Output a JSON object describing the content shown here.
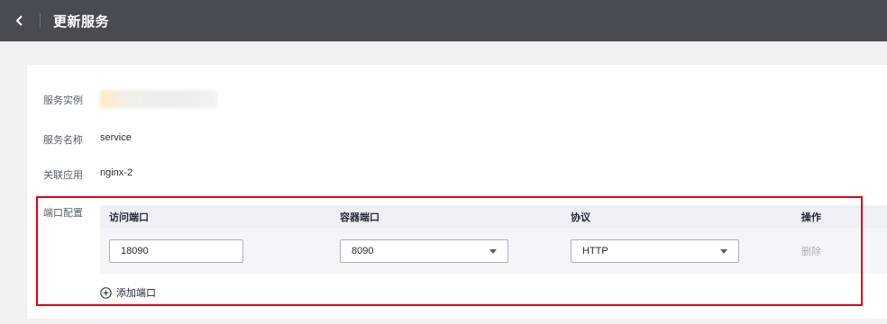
{
  "header": {
    "title": "更新服务",
    "back_icon": "chevron-left-icon"
  },
  "form": {
    "instance": {
      "label": "服务实例",
      "value": ""
    },
    "name": {
      "label": "服务名称",
      "value": "service"
    },
    "app": {
      "label": "关联应用",
      "value": "nginx-2"
    },
    "ports": {
      "label": "端口配置",
      "columns": [
        "访问端口",
        "容器端口",
        "协议",
        "操作"
      ],
      "rows": [
        {
          "access_port": "18090",
          "container_port": "8090",
          "protocol": "HTTP",
          "action": "删除"
        }
      ],
      "add_label": "添加端口",
      "add_icon": "plus-circle-icon"
    }
  },
  "colors": {
    "topbar": "#484b52",
    "highlight": "#e60012",
    "table_header": "#eef0f5",
    "table_row": "#f4f5f8"
  }
}
